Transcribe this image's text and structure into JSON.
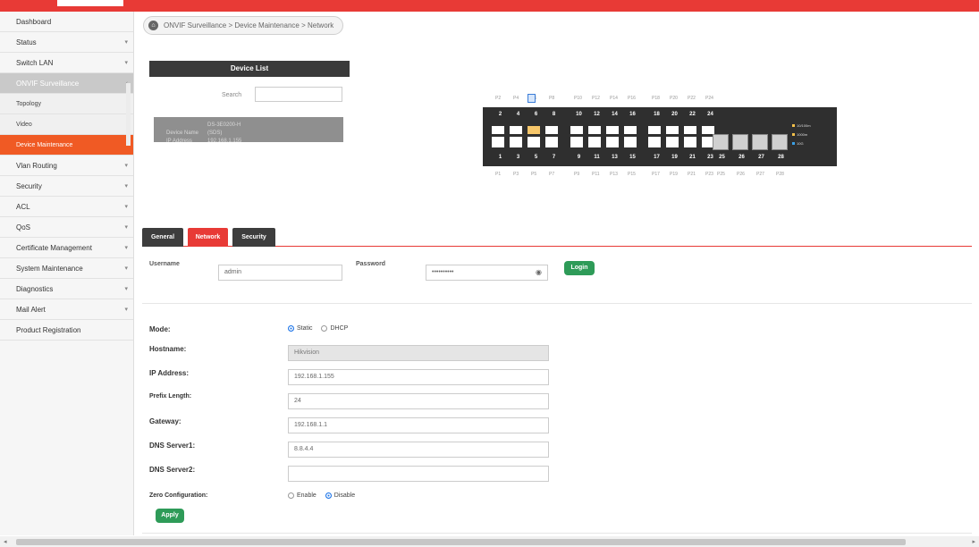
{
  "breadcrumb": "ONVIF Surveillance > Device Maintenance > Network",
  "sidebar": {
    "items": [
      {
        "label": "Dashboard",
        "chevron": false
      },
      {
        "label": "Status",
        "chevron": true
      },
      {
        "label": "Switch LAN",
        "chevron": true
      },
      {
        "label": "ONVIF Surveillance",
        "chevron": true,
        "open": true
      },
      {
        "label": "Topology",
        "sub": true
      },
      {
        "label": "Video",
        "sub": true
      },
      {
        "label": "Device Maintenance",
        "sub": true,
        "active": true
      },
      {
        "label": "Vlan Routing",
        "chevron": true
      },
      {
        "label": "Security",
        "chevron": true
      },
      {
        "label": "ACL",
        "chevron": true
      },
      {
        "label": "QoS",
        "chevron": true
      },
      {
        "label": "Certificate Management",
        "chevron": true
      },
      {
        "label": "System Maintenance",
        "chevron": true
      },
      {
        "label": "Diagnostics",
        "chevron": true
      },
      {
        "label": "Mail Alert",
        "chevron": true
      },
      {
        "label": "Product Registration",
        "chevron": false
      }
    ]
  },
  "device_list": {
    "title": "Device List",
    "search_label": "Search",
    "search_value": "",
    "device": {
      "name_label": "Device Name",
      "name_value": "DS-3E0200-H (SDS)",
      "ip_label": "IP Address",
      "ip_value": "192.168.1.155"
    }
  },
  "switch": {
    "top_port_labels": [
      "P2",
      "P4",
      "P6",
      "P8",
      "P10",
      "P12",
      "P14",
      "P16",
      "P18",
      "P20",
      "P22",
      "P24"
    ],
    "bottom_port_labels": [
      "P1",
      "P3",
      "P5",
      "P7",
      "P9",
      "P11",
      "P13",
      "P15",
      "P17",
      "P19",
      "P21",
      "P23",
      "P25",
      "P26",
      "P27",
      "P28"
    ],
    "top_numbers": [
      "2",
      "4",
      "6",
      "8",
      "10",
      "12",
      "14",
      "16",
      "18",
      "20",
      "22",
      "24"
    ],
    "bottom_numbers": [
      "1",
      "3",
      "5",
      "7",
      "9",
      "11",
      "13",
      "15",
      "17",
      "19",
      "21",
      "23",
      "25",
      "26",
      "27",
      "28"
    ],
    "legend": [
      {
        "label": "10/100m",
        "color": "#f3c04a"
      },
      {
        "label": "1000m",
        "color": "#f3c04a"
      },
      {
        "label": "10G",
        "color": "#3aa0e6"
      }
    ]
  },
  "tabs": [
    {
      "label": "General",
      "active": false
    },
    {
      "label": "Network",
      "active": true
    },
    {
      "label": "Security",
      "active": false
    }
  ],
  "login": {
    "username_label": "Username",
    "username_value": "admin",
    "password_label": "Password",
    "password_value": "••••••••••",
    "login_button": "Login"
  },
  "form": {
    "mode_label": "Mode:",
    "mode_static": "Static",
    "mode_dhcp": "DHCP",
    "hostname_label": "Hostname:",
    "hostname_value": "Hikvision",
    "ip_label": "IP Address:",
    "ip_value": "192.168.1.155",
    "prefix_label": "Prefix Length:",
    "prefix_value": "24",
    "gateway_label": "Gateway:",
    "gateway_value": "192.168.1.1",
    "dns1_label": "DNS Server1:",
    "dns1_value": "8.8.4.4",
    "dns2_label": "DNS Server2:",
    "dns2_value": "",
    "zero_label": "Zero Configuration:",
    "zero_enable": "Enable",
    "zero_disable": "Disable",
    "apply_button": "Apply"
  },
  "colors": {
    "accent": "#e83a36",
    "active_sub": "#f05a24",
    "button": "#2e9b58"
  }
}
